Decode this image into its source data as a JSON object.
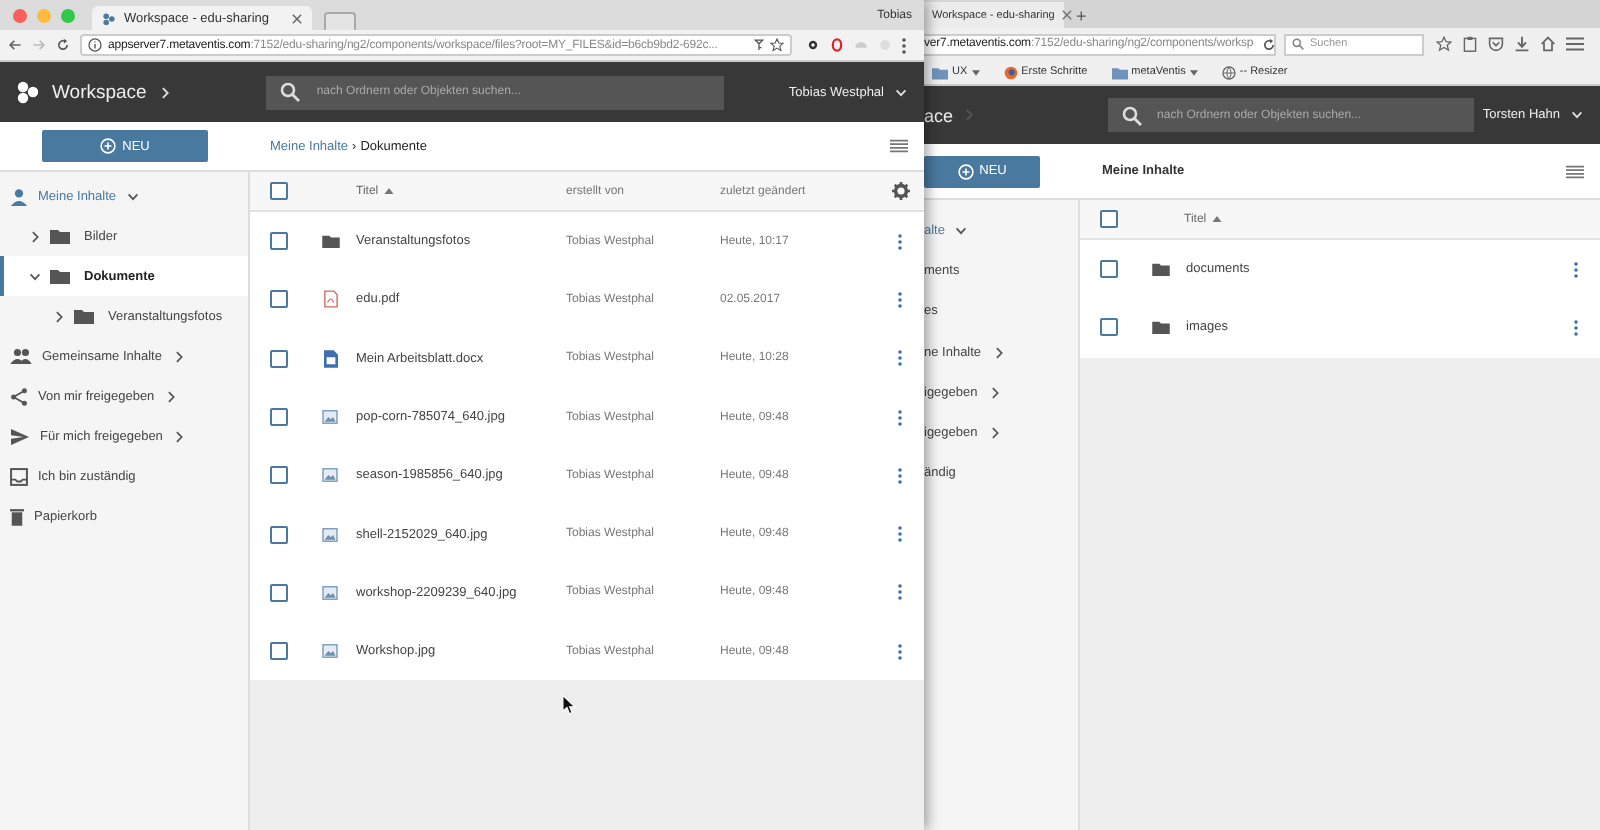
{
  "left_window": {
    "tab_title": "Workspace - edu-sharing",
    "profile_name": "Tobias",
    "url_host": "appserver7.metaventis.com",
    "url_path": ":7152/edu-sharing/ng2/components/workspace/files?root=MY_FILES&id=b6cb9bd2-692c...",
    "app_title": "Workspace",
    "search_placeholder": "nach Ordnern oder Objekten suchen...",
    "user_name": "Tobias Westphal",
    "new_button": "NEU",
    "breadcrumb": [
      {
        "label": "Meine Inhalte",
        "kind": "link"
      },
      {
        "label": "Dokumente",
        "kind": "current"
      }
    ],
    "breadcrumb_separator": "›",
    "sidebar": [
      {
        "label": "Meine Inhalte",
        "kind": "user",
        "expanded": true,
        "selected": false,
        "children": [
          {
            "label": "Bilder",
            "kind": "folder",
            "expanded": false,
            "selected": false
          },
          {
            "label": "Dokumente",
            "kind": "folder",
            "expanded": true,
            "selected": true,
            "children": [
              {
                "label": "Veranstaltungsfotos",
                "kind": "folder",
                "expanded": false,
                "selected": false
              }
            ]
          }
        ]
      },
      {
        "label": "Gemeinsame Inhalte",
        "kind": "group",
        "expanded": false,
        "selected": false
      },
      {
        "label": "Von mir freigegeben",
        "kind": "share",
        "expanded": false,
        "selected": false
      },
      {
        "label": "Für mich freigegeben",
        "kind": "send",
        "expanded": false,
        "selected": false
      },
      {
        "label": "Ich bin zuständig",
        "kind": "inbox",
        "selected": false
      },
      {
        "label": "Papierkorb",
        "kind": "trash",
        "selected": false
      }
    ],
    "table": {
      "all_checked": false,
      "columns": [
        {
          "label": "Titel",
          "sort_ascending": true
        },
        {
          "label": "erstellt von"
        },
        {
          "label": "zuletzt geändert"
        }
      ],
      "rows": [
        {
          "kind": "folder",
          "title": "Veranstaltungsfotos",
          "creator": "Tobias Westphal",
          "modified": "Heute, 10:17",
          "checked": false
        },
        {
          "kind": "pdf",
          "title": "edu.pdf",
          "creator": "Tobias Westphal",
          "modified": "02.05.2017",
          "checked": false
        },
        {
          "kind": "docx",
          "title": "Mein Arbeitsblatt.docx",
          "creator": "Tobias Westphal",
          "modified": "Heute, 10:28",
          "checked": false
        },
        {
          "kind": "image",
          "title": "pop-corn-785074_640.jpg",
          "creator": "Tobias Westphal",
          "modified": "Heute, 09:48",
          "checked": false
        },
        {
          "kind": "image",
          "title": "season-1985856_640.jpg",
          "creator": "Tobias Westphal",
          "modified": "Heute, 09:48",
          "checked": false
        },
        {
          "kind": "image",
          "title": "shell-2152029_640.jpg",
          "creator": "Tobias Westphal",
          "modified": "Heute, 09:48",
          "checked": false
        },
        {
          "kind": "image",
          "title": "workshop-2209239_640.jpg",
          "creator": "Tobias Westphal",
          "modified": "Heute, 09:48",
          "checked": false
        },
        {
          "kind": "image",
          "title": "Workshop.jpg",
          "creator": "Tobias Westphal",
          "modified": "Heute, 09:48",
          "checked": false
        }
      ]
    }
  },
  "right_window": {
    "tab_title": "Workspace - edu-sharing",
    "new_tab": "+",
    "url_host": "ver7.metaventis.com",
    "url_path": ":7152/edu-sharing/ng2/components/worksp",
    "search_placeholder_browser": "Suchen",
    "bookmarks": [
      {
        "label": "UX",
        "kind": "folder",
        "dropdown": true
      },
      {
        "label": "Erste Schritte",
        "kind": "browser"
      },
      {
        "label": "metaVentis",
        "kind": "folder",
        "dropdown": true
      },
      {
        "label": "-- Resizer",
        "kind": "globe"
      }
    ],
    "app_title": "ace",
    "search_placeholder": "nach Ordnern oder Objekten suchen...",
    "user_name": "Torsten Hahn",
    "new_button": "NEU",
    "breadcrumb": "Meine Inhalte",
    "sidebar": [
      {
        "label": "alte",
        "expanded": true,
        "kind": "root"
      },
      {
        "label": "ments",
        "kind": "plain"
      },
      {
        "label": "es",
        "kind": "plain"
      },
      {
        "label": "ne Inhalte",
        "expanded": false,
        "kind": "plain"
      },
      {
        "label": "igegeben",
        "expanded": false,
        "kind": "plain"
      },
      {
        "label": "igegeben",
        "expanded": false,
        "kind": "plain"
      },
      {
        "label": "ändig",
        "kind": "plain"
      }
    ],
    "table": {
      "all_checked": false,
      "columns": [
        {
          "label": "Titel",
          "sort_ascending": true
        }
      ],
      "rows": [
        {
          "kind": "folder",
          "title": "documents",
          "checked": false
        },
        {
          "kind": "folder",
          "title": "images",
          "checked": false
        }
      ]
    }
  }
}
